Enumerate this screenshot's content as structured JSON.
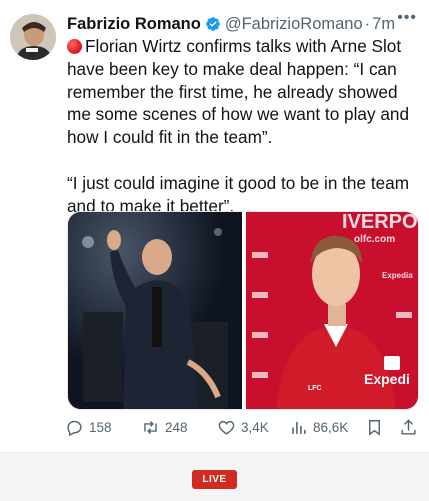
{
  "author": {
    "name": "Fabrizio Romano",
    "handle": "@FabrizioRomano",
    "separator": "·",
    "time": "7m",
    "more_label": "•••"
  },
  "tweet": {
    "paragraph_1": "Florian Wirtz confirms talks with Arne Slot have been key to make deal happen: “I can remember the first time, he already showed me some scenes of how we want to play and how I could fit in the team”.",
    "paragraph_2": "“I just could imagine it good to be in the team and to make it better”."
  },
  "media": {
    "right_banner_text": "IVERPO",
    "right_site_text": "olfc.com",
    "sponsor_text": "Expedi",
    "sponsor_small": "Expedia",
    "club_text": "LFC"
  },
  "actions": {
    "replies": "158",
    "reposts": "248",
    "likes": "3,4K",
    "views": "86,6K"
  },
  "live_badge": "LIVE",
  "colors": {
    "verified": "#1d9bf0",
    "live": "#d12b1f",
    "liverpool_red": "#c8102e",
    "text_secondary": "#536471"
  }
}
